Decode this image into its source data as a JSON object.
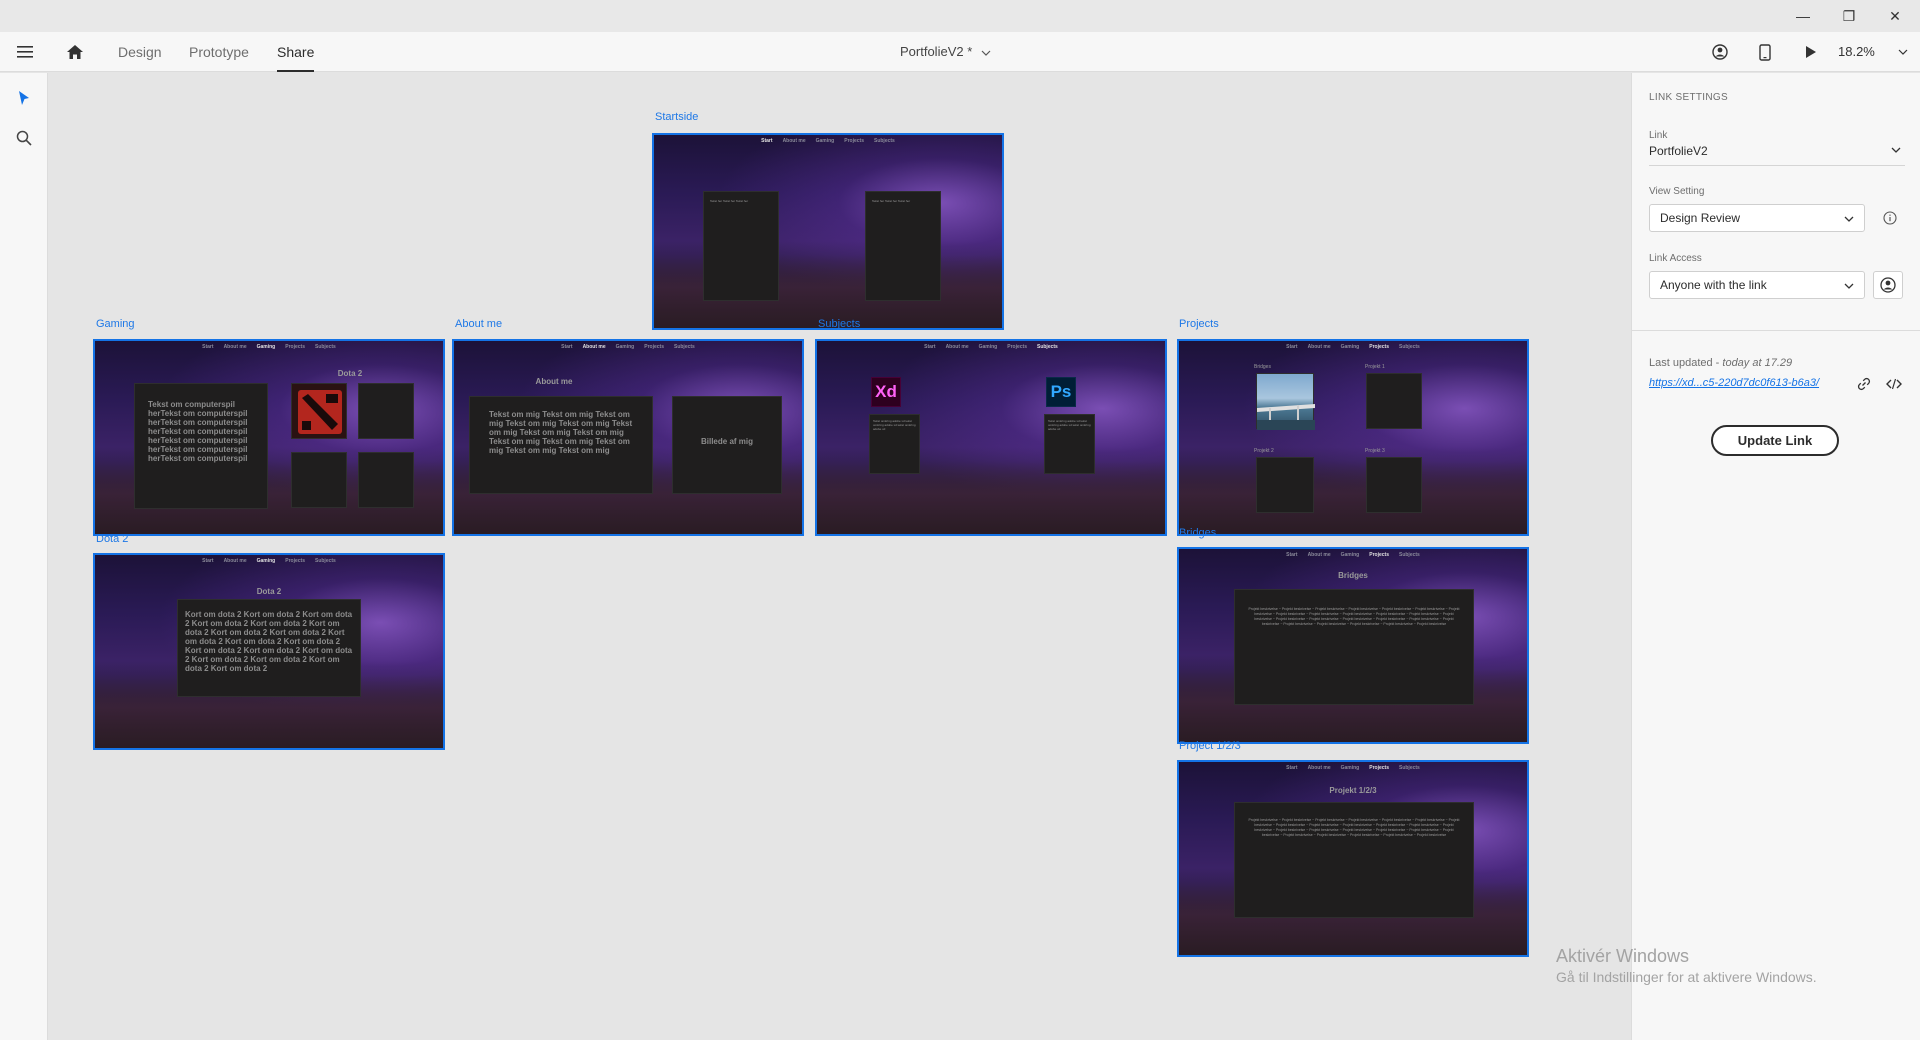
{
  "window": {
    "minimize_glyph": "—",
    "restore_glyph": "❐",
    "close_glyph": "✕"
  },
  "appbar": {
    "tabs": [
      {
        "label": "Design"
      },
      {
        "label": "Prototype"
      },
      {
        "label": "Share",
        "active": true
      }
    ],
    "document_title": "PortfolieV2 *",
    "zoom": "18.2%"
  },
  "artboards": {
    "startside": {
      "label": "Startside",
      "nav": [
        "Start",
        "About me",
        "Gaming",
        "Projects",
        "Subjects"
      ],
      "active_nav": "Start",
      "filler": "Tekst her Tekst her Tekst her"
    },
    "gaming": {
      "label": "Gaming",
      "nav": [
        "Start",
        "About me",
        "Gaming",
        "Projects",
        "Subjects"
      ],
      "active_nav": "Gaming",
      "text": "Tekst om computerspil herTekst om computerspil herTekst om computerspil herTekst om computerspil herTekst om computerspil herTekst om computerspil herTekst om computerspil",
      "heading": "Dota 2"
    },
    "about_me": {
      "label": "About me",
      "nav": [
        "Start",
        "About me",
        "Gaming",
        "Projects",
        "Subjects"
      ],
      "active_nav": "About me",
      "heading": "About me",
      "text": "Tekst om mig Tekst om mig Tekst om mig Tekst om mig Tekst om mig Tekst om mig Tekst om mig Tekst om mig Tekst om mig Tekst om mig Tekst om mig Tekst om mig Tekst om mig",
      "image_placeholder": "Billede af mig"
    },
    "subjects": {
      "label": "Subjects",
      "nav": [
        "Start",
        "About me",
        "Gaming",
        "Projects",
        "Subjects"
      ],
      "active_nav": "Subjects",
      "xd_logo": "Xd",
      "ps_logo": "Ps",
      "filler": "Tekst omkring adobe xd tekst omkring adobe xd tekst omkring adobe xd"
    },
    "projects": {
      "label": "Projects",
      "nav": [
        "Start",
        "About me",
        "Gaming",
        "Projects",
        "Subjects"
      ],
      "active_nav": "Projects",
      "tiles": [
        "Bridges",
        "Projekt 1",
        "Projekt 2",
        "Projekt 3"
      ]
    },
    "dota2": {
      "label": "Dota 2",
      "nav": [
        "Start",
        "About me",
        "Gaming",
        "Projects",
        "Subjects"
      ],
      "active_nav": "Gaming",
      "heading": "Dota 2",
      "text": "Kort om dota 2 Kort om dota 2 Kort om dota 2 Kort om dota 2 Kort om dota 2 Kort om dota 2 Kort om dota 2 Kort om dota 2 Kort om dota 2 Kort om dota 2 Kort om dota 2 Kort om dota 2 Kort om dota 2 Kort om dota 2 Kort om dota 2 Kort om dota 2 Kort om dota 2 Kort om dota 2"
    },
    "bridges": {
      "label": "Bridges",
      "nav": [
        "Start",
        "About me",
        "Gaming",
        "Projects",
        "Subjects"
      ],
      "active_nav": "Projects",
      "heading": "Bridges",
      "filler": "Projekt beskrivelse ~ Projekt beskrivelse ~ Projekt beskrivelse ~ Projekt beskrivelse ~ Projekt beskrivelse ~ Projekt beskrivelse ~ Projekt beskrivelse ~ Projekt beskrivelse ~ Projekt beskrivelse ~ Projekt beskrivelse ~ Projekt beskrivelse ~ Projekt beskrivelse ~ Projekt beskrivelse ~ Projekt beskrivelse ~ Projekt beskrivelse ~ Projekt beskrivelse ~ Projekt beskrivelse ~ Projekt beskrivelse ~ Projekt beskrivelse ~ Projekt beskrivelse ~ Projekt beskrivelse ~ Projekt beskrivelse ~ Projekt beskrivelse ~ Projekt beskrivelse"
    },
    "project123": {
      "label": "Project 1/2/3",
      "nav": [
        "Start",
        "About me",
        "Gaming",
        "Projects",
        "Subjects"
      ],
      "active_nav": "Projects",
      "heading": "Projekt 1/2/3",
      "filler": "Projekt beskrivelse ~ Projekt beskrivelse ~ Projekt beskrivelse ~ Projekt beskrivelse ~ Projekt beskrivelse ~ Projekt beskrivelse ~ Projekt beskrivelse ~ Projekt beskrivelse ~ Projekt beskrivelse ~ Projekt beskrivelse ~ Projekt beskrivelse ~ Projekt beskrivelse ~ Projekt beskrivelse ~ Projekt beskrivelse ~ Projekt beskrivelse ~ Projekt beskrivelse ~ Projekt beskrivelse ~ Projekt beskrivelse ~ Projekt beskrivelse ~ Projekt beskrivelse ~ Projekt beskrivelse ~ Projekt beskrivelse ~ Projekt beskrivelse ~ Projekt beskrivelse"
    }
  },
  "link_settings": {
    "header": "LINK SETTINGS",
    "link_label": "Link",
    "link_value": "PortfolieV2",
    "view_setting_label": "View Setting",
    "view_setting_value": "Design Review",
    "link_access_label": "Link Access",
    "link_access_value": "Anyone with the link",
    "last_updated_prefix": "Last updated - ",
    "last_updated_value": "today at 17.29",
    "url": "https://xd...c5-220d7dc0f613-b6a3/",
    "update_button": "Update Link"
  },
  "watermark": {
    "line1": "Aktivér Windows",
    "line2": "Gå til Indstillinger for at aktivere Windows."
  },
  "colors": {
    "accent": "#1473e6",
    "selection_blue": "#1e78e6",
    "xd_brand": "#ff61f6",
    "ps_brand": "#31a8ff"
  }
}
